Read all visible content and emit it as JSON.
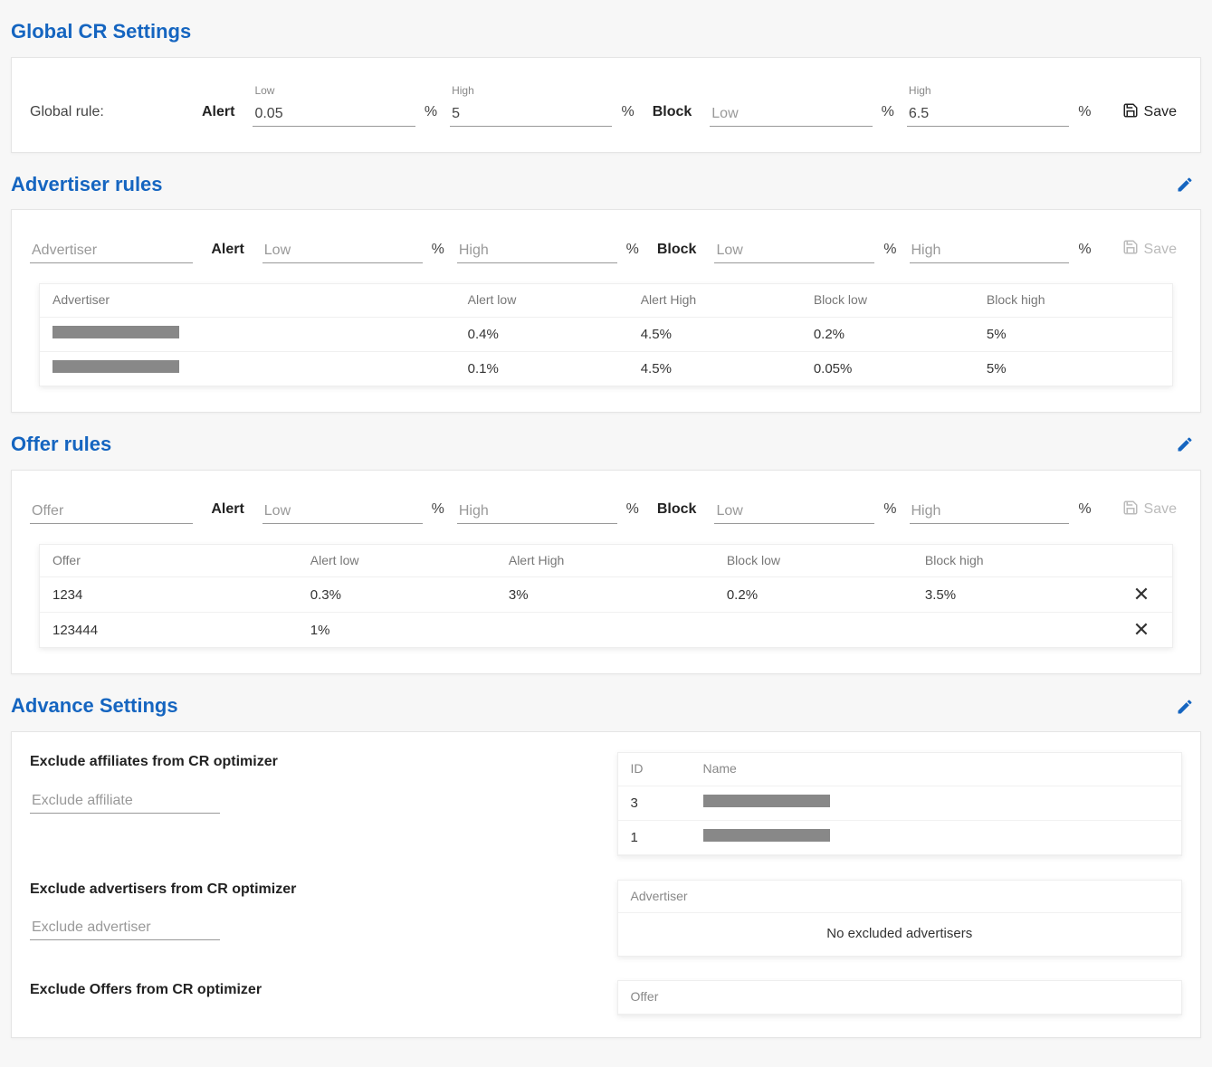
{
  "global": {
    "title": "Global CR Settings",
    "rule_label": "Global rule:",
    "alert_label": "Alert",
    "block_label": "Block",
    "low_label": "Low",
    "high_label": "High",
    "low_placeholder": "Low",
    "alert_low": "0.05",
    "alert_high": "5",
    "block_low": "",
    "block_high": "6.5",
    "save_label": "Save"
  },
  "percent": "%",
  "advertiser": {
    "title": "Advertiser rules",
    "entity_placeholder": "Advertiser",
    "alert_label": "Alert",
    "block_label": "Block",
    "low_placeholder": "Low",
    "high_placeholder": "High",
    "save_label": "Save",
    "headers": {
      "entity": "Advertiser",
      "alert_low": "Alert low",
      "alert_high": "Alert High",
      "block_low": "Block low",
      "block_high": "Block high"
    },
    "rows": [
      {
        "alert_low": "0.4%",
        "alert_high": "4.5%",
        "block_low": "0.2%",
        "block_high": "5%"
      },
      {
        "alert_low": "0.1%",
        "alert_high": "4.5%",
        "block_low": "0.05%",
        "block_high": "5%"
      }
    ]
  },
  "offer": {
    "title": "Offer rules",
    "entity_placeholder": "Offer",
    "alert_label": "Alert",
    "block_label": "Block",
    "low_placeholder": "Low",
    "high_placeholder": "High",
    "save_label": "Save",
    "headers": {
      "entity": "Offer",
      "alert_low": "Alert low",
      "alert_high": "Alert High",
      "block_low": "Block low",
      "block_high": "Block high"
    },
    "rows": [
      {
        "offer": "1234",
        "alert_low": "0.3%",
        "alert_high": "3%",
        "block_low": "0.2%",
        "block_high": "3.5%"
      },
      {
        "offer": "123444",
        "alert_low": "1%",
        "alert_high": "",
        "block_low": "",
        "block_high": ""
      }
    ]
  },
  "advance": {
    "title": "Advance Settings",
    "exclude_affiliates_title": "Exclude affiliates from CR optimizer",
    "exclude_affiliate_placeholder": "Exclude affiliate",
    "exclude_advertisers_title": "Exclude advertisers from CR optimizer",
    "exclude_advertiser_placeholder": "Exclude advertiser",
    "exclude_offers_title": "Exclude Offers from CR optimizer",
    "affiliates_table": {
      "id_header": "ID",
      "name_header": "Name",
      "rows": [
        {
          "id": "3"
        },
        {
          "id": "1"
        }
      ]
    },
    "advertisers_table": {
      "header": "Advertiser",
      "empty": "No excluded advertisers"
    },
    "offers_table": {
      "header": "Offer"
    }
  }
}
